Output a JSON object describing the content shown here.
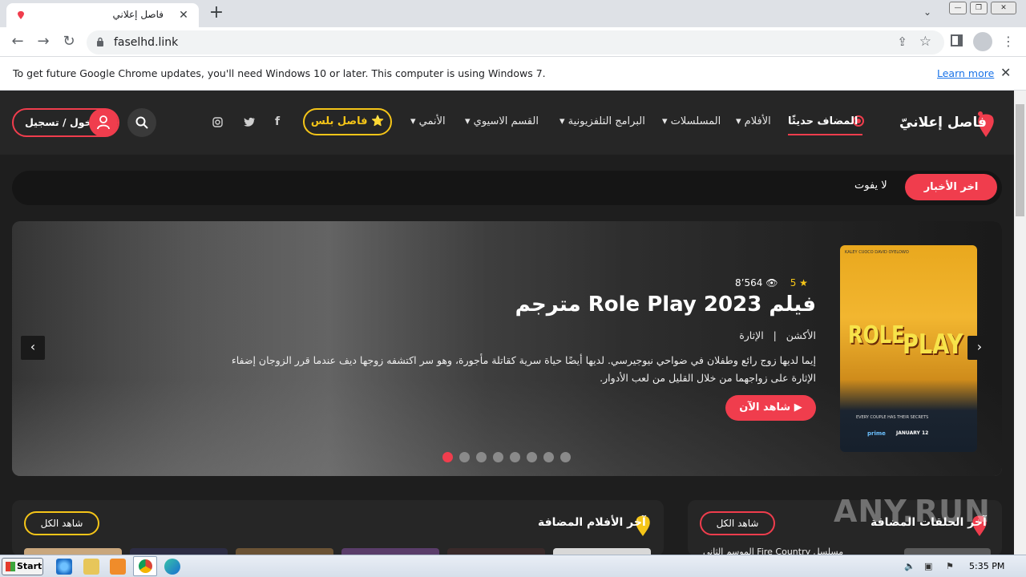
{
  "browser": {
    "tab_title": "فاصل إعلاني",
    "tab_close": "✕",
    "new_tab": "+",
    "url": "faselhd.link",
    "minimize": "—",
    "restore": "❐",
    "close": "✕"
  },
  "infobar": {
    "message": "To get future Google Chrome updates, you'll need Windows 10 or later. This computer is using Windows 7.",
    "learn_more": "Learn more",
    "close": "✕"
  },
  "site": {
    "logo": "فاصل إعلانيّ",
    "nav": {
      "recent": "المضاف حديثًا",
      "movies": "الأفلام",
      "series": "المسلسلات",
      "tv": "البرامج التلفزيونية",
      "asian": "القسم الاسيوي",
      "anime": "الأنمي"
    },
    "plus": "⭐ فاصل بلس",
    "login": "دخول / تسجيل",
    "ticker": {
      "badge": "اخر الأخبار",
      "text": "لا يفوت"
    },
    "featured": {
      "rating": "5",
      "views": "8’564",
      "title": "فيلم Role Play 2023 مترجم",
      "genre1": "الأكشن",
      "genre2": "الإثارة",
      "description": "إيما لديها زوج رائع وطفلان في ضواحي نيوجيرسي. لديها أيضًا حياة سرية كقاتلة مأجورة، وهو سر اكتشفه زوجها ديف عندما قرر الزوجان إضفاء الإثارة على زواجهما من خلال القليل من لعب الأدوار.",
      "watch_now": "شاهد الآن",
      "poster": {
        "actors": "KALEY CUOCO        DAVID OYELOWO",
        "word1": "ROLE",
        "word2": "PLAY",
        "tagline": "EVERY COUPLE HAS THEIR SECRETS",
        "brand": "prime",
        "date": "JANUARY 12"
      }
    },
    "slider": {
      "slide_count": 8,
      "active_index": 0
    },
    "sections": {
      "movies_title": "آخر الأفلام المضافة",
      "movies_see_all": "شاهد الكل",
      "episodes_title": "آخر الحلقات المضافة",
      "episodes_see_all": "شاهد الكل",
      "episode_item": "مسلسل Fire Country الموسم الثاني"
    },
    "watermark": "ANY.RUN"
  },
  "taskbar": {
    "start": "Start",
    "clock": "5:35 PM"
  },
  "colors": {
    "accent": "#f03d4d",
    "gold": "#f5c518"
  }
}
